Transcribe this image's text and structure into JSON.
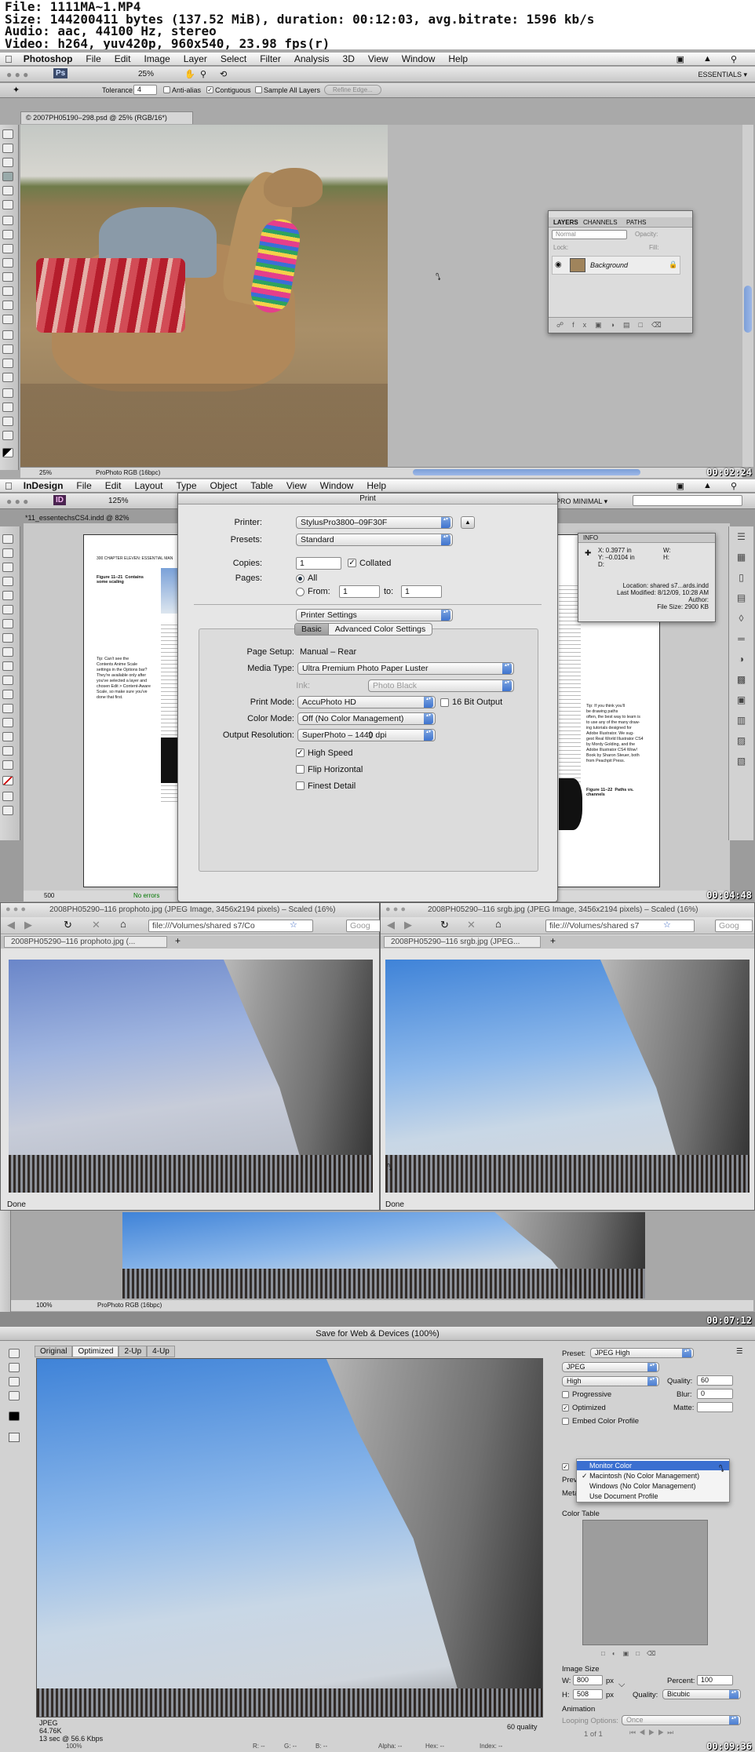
{
  "header": {
    "lines": [
      "File: 1111MA~1.MP4",
      "Size: 144200411 bytes (137.52 MiB), duration: 00:12:03, avg.bitrate: 1596 kb/s",
      "Audio: aac, 44100 Hz, stereo",
      "Video: h264, yuv420p, 960x540, 23.98 fps(r)"
    ]
  },
  "frame1": {
    "menu": [
      "Photoshop",
      "File",
      "Edit",
      "Image",
      "Layer",
      "Select",
      "Filter",
      "Analysis",
      "3D",
      "View",
      "Window",
      "Help"
    ],
    "zoom": "25%",
    "essentials": "ESSENTIALS ▾",
    "options": {
      "tolerance_label": "Tolerance:",
      "tolerance_value": "4",
      "anti_alias": "Anti-alias",
      "contiguous": "Contiguous",
      "sample_all": "Sample All Layers",
      "refine": "Refine Edge..."
    },
    "doc_tab": "© 2007PH05190–298.psd @ 25% (RGB/16*)",
    "status": {
      "zoom": "25%",
      "profile": "ProPhoto RGB (16bpc)"
    },
    "layers": {
      "tabs": [
        "LAYERS",
        "CHANNELS",
        "PATHS"
      ],
      "blend": "Normal",
      "opacity_label": "Opacity:",
      "lock_label": "Lock:",
      "fill_label": "Fill:",
      "layer_name": "Background"
    },
    "timestamp": "00:02:24"
  },
  "frame2": {
    "menu": [
      "InDesign",
      "File",
      "Edit",
      "Layout",
      "Type",
      "Object",
      "Table",
      "View",
      "Window",
      "Help"
    ],
    "zoom": "125%",
    "workspace": "PRO MINIMAL ▾",
    "doc_tab": "*11_essentechsCS4.indd @ 82%",
    "dialog": {
      "title": "Print",
      "printer_label": "Printer:",
      "printer": "StylusPro3800–09F30F",
      "presets_label": "Presets:",
      "presets": "Standard",
      "copies_label": "Copies:",
      "copies": "1",
      "collated": "Collated",
      "pages_label": "Pages:",
      "all": "All",
      "from_label": "From:",
      "from": "1",
      "to_label": "to:",
      "to": "1",
      "section": "Printer Settings",
      "tabs": [
        "Basic",
        "Advanced Color Settings"
      ],
      "page_setup_label": "Page Setup:",
      "page_setup": "Manual – Rear",
      "media_label": "Media Type:",
      "media": "Ultra Premium Photo Paper Luster",
      "ink_label": "Ink:",
      "ink": "Photo Black",
      "print_mode_label": "Print Mode:",
      "print_mode": "AccuPhoto HD",
      "bit16": "16 Bit Output",
      "color_mode_label": "Color Mode:",
      "color_mode": "Off (No Color Management)",
      "output_label": "Output Resolution:",
      "output": "SuperPhoto – 1440 dpi",
      "high_speed": "High Speed",
      "flip": "Flip Horizontal",
      "finest": "Finest Detail"
    },
    "info": {
      "title": "INFO",
      "x": "X: 0.3977 in",
      "y": "Y: –0.0104 in",
      "d": "D:",
      "w": "W:",
      "h": "H:",
      "location": "Location: shared s7...ards.indd",
      "modified": "Last Modified: 8/12/09, 10:28 AM",
      "author": "Author:",
      "size": "File Size: 2900 KB"
    },
    "page_text": {
      "chapter": "300   CHAPTER ELEVEN: ESSENTIAL MAN",
      "fig21": "Figure 11–21  Contains\nsome scaling",
      "tip_left": "Tip: Can't see the\nContents Anime Scale\nsettings in the Options bar?\nThey're available only after\nyou've selected a layer and\nchosen Edit > Content-Aware\nScale, so make sure you've\ndone that first.",
      "tip_right": "Tip: If you think you'll\nbe drawing paths\noften, the best way to learn is\nto use any of the many draw-\ning tutorials designed for\nAdobe Illustrator. We sug-\ngest Real World Illustrator CS4\nby Mordy Golding, and the\nAdobe Illustrator CS4 Wow!\nBook by Sharon Steuer, both\nfrom Peachpit Press.",
      "fig22": "Figure 11–22  Paths vs.\nchannels"
    },
    "status": {
      "page": "500",
      "errors": "No errors"
    },
    "timestamp": "00:04:48"
  },
  "frame3": {
    "win_left": {
      "title": "2008PH05290–116 prophoto.jpg (JPEG Image, 3456x2194 pixels) – Scaled (16%)",
      "url": "file:///Volumes/shared s7/Co",
      "tab": "2008PH05290–116 prophoto.jpg (...",
      "status": "Done"
    },
    "win_right": {
      "title": "2008PH05290–116 srgb.jpg (JPEG Image, 3456x2194 pixels) – Scaled (16%)",
      "url": "file:///Volumes/shared s7",
      "tab": "2008PH05290–116 srgb.jpg (JPEG...",
      "status": "Done"
    },
    "search": "Goog",
    "status": {
      "zoom": "100%",
      "profile": "ProPhoto RGB (16bpc)"
    },
    "timestamp": "00:07:12"
  },
  "frame4": {
    "title": "Save for Web & Devices (100%)",
    "view_tabs": [
      "Original",
      "Optimized",
      "2-Up",
      "4-Up"
    ],
    "preset_label": "Preset:",
    "preset": "JPEG High",
    "format": "JPEG",
    "quality_level": "High",
    "quality_label": "Quality:",
    "quality": "60",
    "blur_label": "Blur:",
    "blur": "0",
    "matte_label": "Matte:",
    "progressive": "Progressive",
    "optimized": "Optimized",
    "embed": "Embed Color Profile",
    "preview_label": "Previe",
    "metadata_label": "Metad",
    "menu_items": [
      "Monitor Color",
      "Macintosh (No Color Management)",
      "Windows (No Color Management)",
      "Use Document Profile"
    ],
    "menu_checked": "✓",
    "color_table": "Color Table",
    "image_size": "Image Size",
    "w_label": "W:",
    "w": "800",
    "h_label": "H:",
    "h": "508",
    "px": "px",
    "percent_label": "Percent:",
    "percent": "100",
    "resample_label": "Quality:",
    "resample": "Bicubic",
    "animation": "Animation",
    "looping_label": "Looping Options:",
    "looping": "Once",
    "frame_count": "1 of 1",
    "info": {
      "format": "JPEG",
      "size": "64.76K",
      "time": "13 sec @ 56.6 Kbps",
      "quality": "60 quality"
    },
    "bottom": {
      "zoom": "100%",
      "r": "R: --",
      "g": "G: --",
      "b": "B: --",
      "alpha": "Alpha: --",
      "hex": "Hex: --",
      "index": "Index: --"
    },
    "timestamp": "00:09:36"
  }
}
